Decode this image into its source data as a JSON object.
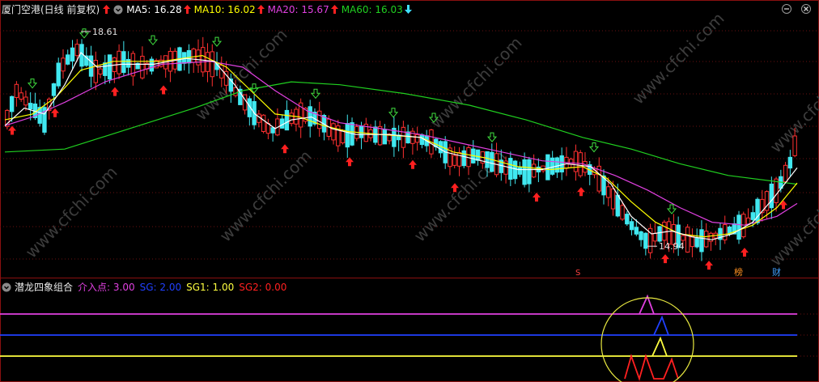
{
  "main_legend": {
    "title": "厦门空港(日线 前复权)",
    "items": [
      {
        "label": "MA5: 16.28",
        "color": "#ffffff",
        "arrow": "up",
        "arrow_color": "#ff2020"
      },
      {
        "label": "MA10: 16.02",
        "color": "#ffff00",
        "arrow": "up",
        "arrow_color": "#ff2020"
      },
      {
        "label": "MA20: 15.67",
        "color": "#e040e0",
        "arrow": "up",
        "arrow_color": "#ff2020"
      },
      {
        "label": "MA60: 16.03",
        "color": "#20d020",
        "arrow": "down",
        "arrow_color": "#40e0ff"
      }
    ],
    "title_icon": "red-up-arrow-icon",
    "collapse_icon": "circle-chevron-icon"
  },
  "sub_legend": {
    "title": "潜龙四象组合",
    "items": [
      {
        "label": "介入点: 3.00",
        "color": "#e040e0"
      },
      {
        "label": "SG: 2.00",
        "color": "#2040ff"
      },
      {
        "label": "SG1: 1.00",
        "color": "#ffff40"
      },
      {
        "label": "SG2: 0.00",
        "color": "#ff2020"
      }
    ]
  },
  "annotations": {
    "high_label": "18.61",
    "low_label": "14.94",
    "tag_s": "S",
    "tag_bang": "榜",
    "tag_cai": "财"
  },
  "watermark": "www.cfchi.com",
  "window_icons": [
    "minimize-icon",
    "close-icon"
  ],
  "chart_data": [
    {
      "type": "candlestick",
      "title": "厦门空港(日线 前复权)",
      "price_range": [
        14.5,
        18.9
      ],
      "high_marker": 18.61,
      "low_marker": 14.94,
      "series": [
        {
          "name": "MA5",
          "last": 16.28,
          "color": "#ffffff"
        },
        {
          "name": "MA10",
          "last": 16.02,
          "color": "#ffff00"
        },
        {
          "name": "MA20",
          "last": 15.67,
          "color": "#e040e0"
        },
        {
          "name": "MA60",
          "last": 16.03,
          "color": "#20d020"
        }
      ]
    },
    {
      "type": "line",
      "title": "潜龙四象组合",
      "series": [
        {
          "name": "介入点",
          "value": 3.0,
          "color": "#e040e0"
        },
        {
          "name": "SG",
          "value": 2.0,
          "color": "#2040ff"
        },
        {
          "name": "SG1",
          "value": 1.0,
          "color": "#ffff40"
        },
        {
          "name": "SG2",
          "value": 0.0,
          "color": "#ff2020"
        }
      ]
    }
  ]
}
